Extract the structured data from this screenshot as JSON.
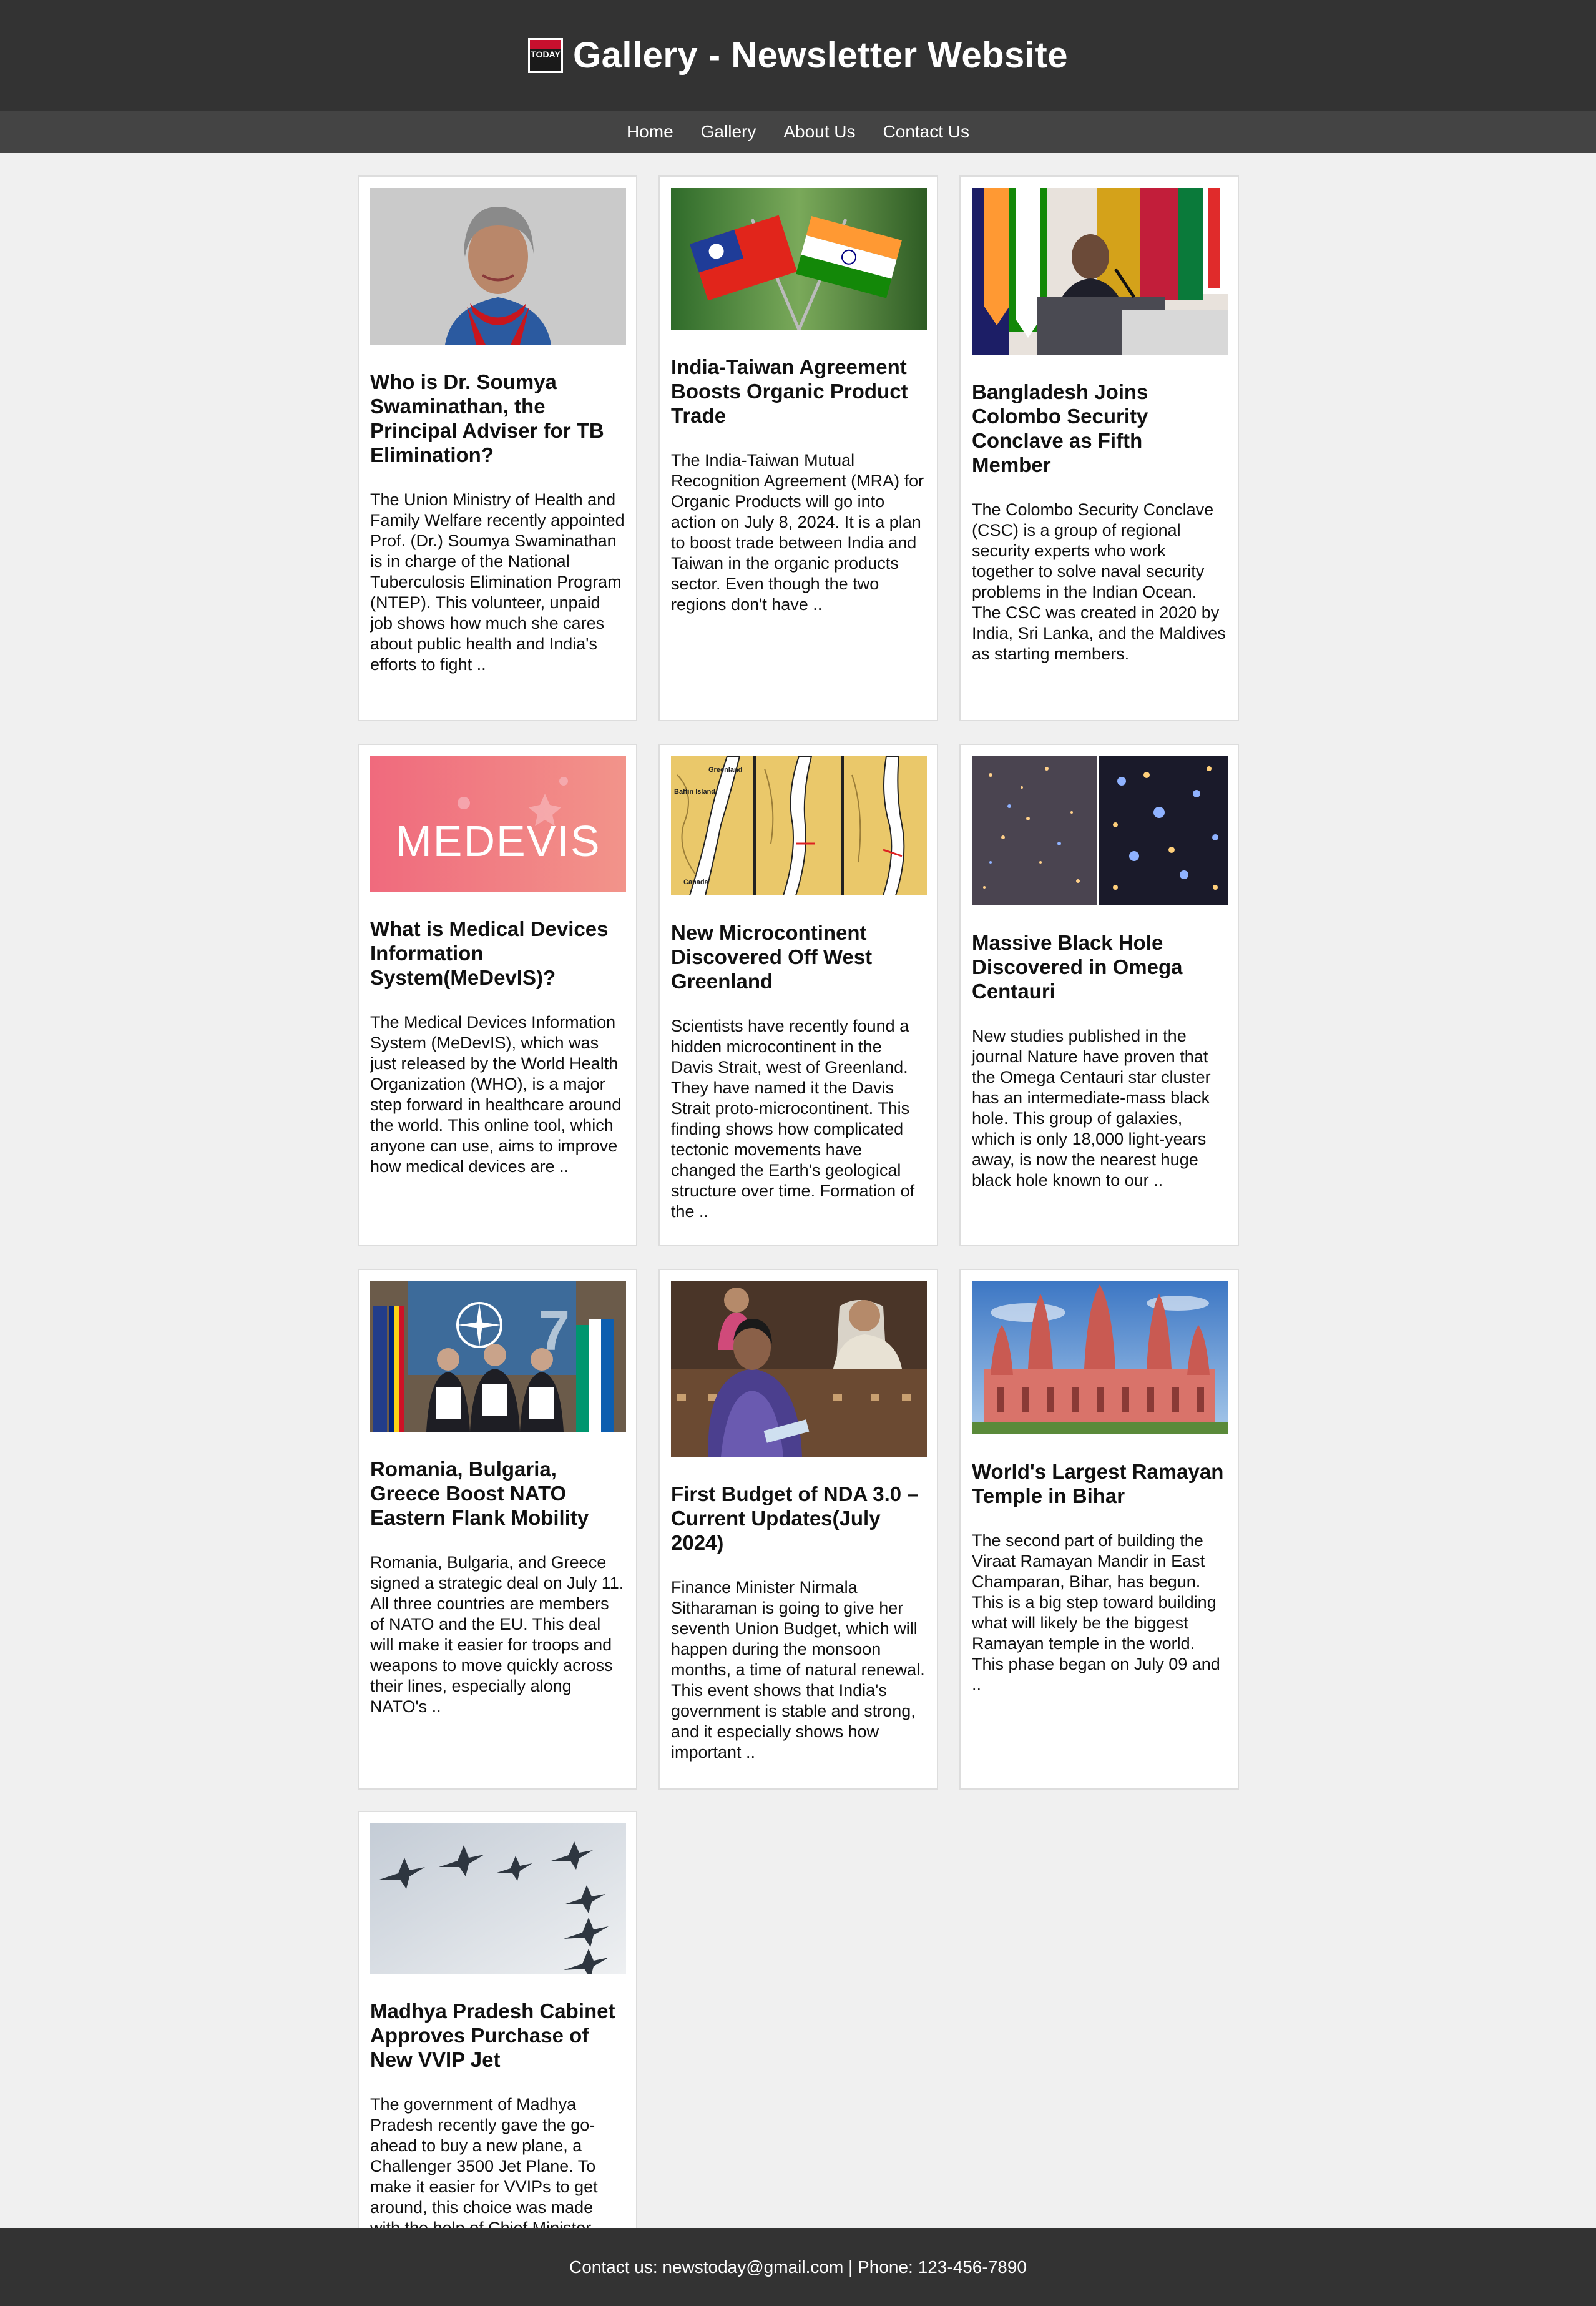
{
  "header": {
    "title": "Gallery - Newsletter Website",
    "logo_text": "TODAY"
  },
  "nav": [
    "Home",
    "Gallery",
    "About Us",
    "Contact Us"
  ],
  "articles": [
    {
      "title": "Who is Dr. Soumya Swaminathan, the Principal Adviser for TB Elimination?",
      "excerpt": "The Union Ministry of Health and Family Welfare recently appointed Prof. (Dr.) Soumya Swaminathan is in charge of the National Tuberculosis Elimination Program (NTEP). This volunteer, unpaid job shows how much she cares about public health and India's efforts to fight ..",
      "image": "portrait-woman-photo"
    },
    {
      "title": "India-Taiwan Agreement Boosts Organic Product Trade",
      "excerpt": "The India-Taiwan Mutual Recognition Agreement (MRA) for Organic Products will go into action on July 8, 2024. It is a plan to boost trade between India and Taiwan in the organic products sector. Even though the two regions don't have ..",
      "image": "crossed-flags-photo"
    },
    {
      "title": "Bangladesh Joins Colombo Security Conclave as Fifth Member",
      "excerpt": "The Colombo Security Conclave (CSC) is a group of regional security experts who work together to solve naval security problems in the Indian Ocean. The CSC was created in 2020 by India, Sri Lanka, and the Maldives as starting members.",
      "image": "speaker-podium-photo"
    },
    {
      "title": "What is Medical Devices Information System(MeDevIS)?",
      "excerpt": "The Medical Devices Information System (MeDevIS), which was just released by the World Health Organization (WHO), is a major step forward in healthcare around the world. This online tool, which anyone can use, aims to improve how medical devices are ..",
      "image": "medevis-banner",
      "image_text": "MEDEVIS"
    },
    {
      "title": "New Microcontinent Discovered Off West Greenland",
      "excerpt": "Scientists have recently found a hidden microcontinent in the Davis Strait, west of Greenland. They have named it the Davis Strait proto-microcontinent. This finding shows how complicated tectonic movements have changed the Earth's geological structure over time. Formation of the ..",
      "image": "geology-map",
      "image_labels": [
        "Greenland",
        "Baffin Island",
        "Canada"
      ]
    },
    {
      "title": "Massive Black Hole Discovered in Omega Centauri",
      "excerpt": "New studies published in the journal Nature have proven that the Omega Centauri star cluster has an intermediate-mass black hole. This group of galaxies, which is only 18,000 light-years away, is now the nearest huge black hole known to our ..",
      "image": "star-cluster-photo"
    },
    {
      "title": "Romania, Bulgaria, Greece Boost NATO Eastern Flank Mobility",
      "excerpt": "Romania, Bulgaria, and Greece signed a strategic deal on July 11. All three countries are members of NATO and the EU. This deal will make it easier for troops and weapons to move quickly across their lines, especially along NATO's ..",
      "image": "nato-signing-photo"
    },
    {
      "title": "First Budget of NDA 3.0 – Current Updates(July 2024)",
      "excerpt": "Finance Minister Nirmala Sitharaman is going to give her seventh Union Budget, which will happen during the monsoon months, a time of natural renewal. This event shows that India's government is stable and strong, and it especially shows how important ..",
      "image": "parliament-photo"
    },
    {
      "title": "World's Largest Ramayan Temple in Bihar",
      "excerpt": "The second part of building the Viraat Ramayan Mandir in East Champaran, Bihar, has begun. This is a big step toward building what will likely be the biggest Ramayan temple in the world. This phase began on July 09 and ..",
      "image": "temple-photo"
    },
    {
      "title": "Madhya Pradesh Cabinet Approves Purchase of New VVIP Jet",
      "excerpt": "The government of Madhya Pradesh recently gave the go-ahead to buy a new plane, a Challenger 3500 Jet Plane. To make it easier for VVIPs to get around, this choice was made with the help of Chief Minister ..",
      "image": "jets-formation-photo"
    }
  ],
  "footer": {
    "text": "Contact us: newstoday@gmail.com | Phone: 123-456-7890"
  }
}
